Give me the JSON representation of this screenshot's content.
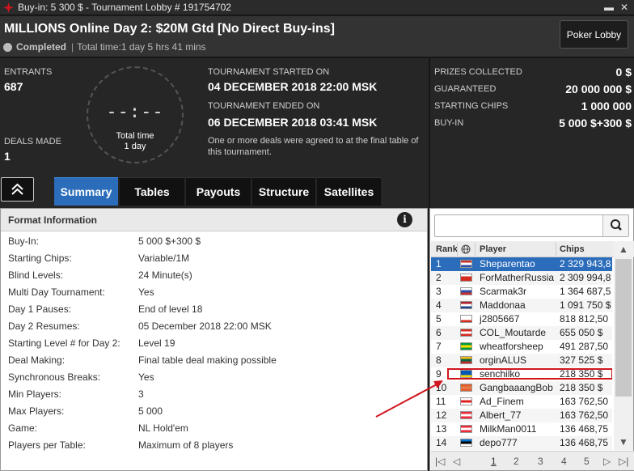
{
  "window": {
    "title": "Buy-in: 5 300 $ - Tournament Lobby # 191754702",
    "minimize_glyph": "▬",
    "close_glyph": "✕"
  },
  "header": {
    "tournament_name": "MILLIONS Online Day 2: $20M Gtd [No Direct Buy-ins]",
    "status": "Completed",
    "separator": "|",
    "total_time": "Total time:1 day 5 hrs  41 mins",
    "lobby_button": "Poker Lobby"
  },
  "info": {
    "entrants_label": "ENTRANTS",
    "entrants_value": "687",
    "deals_label": "DEALS MADE",
    "deals_value": "1",
    "clock_digits": "--:--",
    "clock_line1": "Total time",
    "clock_line2": "1 day",
    "started_label": "TOURNAMENT STARTED ON",
    "started_value": "04 DECEMBER 2018  22:00 MSK",
    "ended_label": "TOURNAMENT ENDED ON",
    "ended_value": "06 DECEMBER 2018  03:41 MSK",
    "note": "One or more deals were agreed to at the final table of this tournament."
  },
  "prizes": [
    {
      "label": "PRIZES COLLECTED",
      "value": "0 $"
    },
    {
      "label": "GUARANTEED",
      "value": "20 000 000 $"
    },
    {
      "label": "STARTING CHIPS",
      "value": "1 000 000"
    },
    {
      "label": "BUY-IN",
      "value": "5 000 $+300 $"
    }
  ],
  "collapse_glyph": "︽",
  "tabs": [
    {
      "label": "Summary",
      "active": true
    },
    {
      "label": "Tables",
      "active": false
    },
    {
      "label": "Payouts",
      "active": false
    },
    {
      "label": "Structure",
      "active": false
    },
    {
      "label": "Satellites",
      "active": false
    }
  ],
  "format": {
    "title": "Format Information",
    "info_glyph": "i",
    "rows": [
      {
        "k": "Buy-In:",
        "v": "5 000 $+300 $"
      },
      {
        "k": "Starting Chips:",
        "v": "Variable/1M"
      },
      {
        "k": "Blind Levels:",
        "v": "24 Minute(s)"
      },
      {
        "k": "Multi Day Tournament:",
        "v": "Yes"
      },
      {
        "k": "Day 1 Pauses:",
        "v": "End of level 18"
      },
      {
        "k": "Day 2 Resumes:",
        "v": "05 December 2018  22:00 MSK"
      },
      {
        "k": "Starting Level # for Day 2:",
        "v": "Level 19"
      },
      {
        "k": "Deal Making:",
        "v": "Final table deal making possible"
      },
      {
        "k": "Synchronous Breaks:",
        "v": "Yes"
      },
      {
        "k": "Min Players:",
        "v": "3"
      },
      {
        "k": "Max Players:",
        "v": "5 000"
      },
      {
        "k": "Game:",
        "v": "NL Hold'em"
      },
      {
        "k": "Players per Table:",
        "v": "Maximum of 8 players"
      }
    ]
  },
  "players": {
    "search_placeholder": "",
    "columns": {
      "rank": "Rank",
      "player": "Player",
      "chips": "Chips"
    },
    "highlighted_rank": 9,
    "rows": [
      {
        "rank": "1",
        "name": "Sheparentao",
        "chips": "2 329 943,8",
        "flag": [
          "#cc2b2b",
          "#ffffff",
          "#2b4fa8"
        ]
      },
      {
        "rank": "2",
        "name": "ForMatherRussia",
        "chips": "2 309 994,8",
        "flag": [
          "#ffffff",
          "#d52b1e",
          "#d52b1e"
        ]
      },
      {
        "rank": "3",
        "name": "Scarmak3r",
        "chips": "1 364 687,5",
        "flag": [
          "#ffffff",
          "#2b4fa8",
          "#cc2b2b"
        ]
      },
      {
        "rank": "4",
        "name": "Maddonaa",
        "chips": "1 091 750 $",
        "flag": [
          "#ae1c28",
          "#ffffff",
          "#21468b"
        ]
      },
      {
        "rank": "5",
        "name": "j2805667",
        "chips": "818 812,50",
        "flag": [
          "#ffffff",
          "#ffffff",
          "#d52b1e"
        ]
      },
      {
        "rank": "6",
        "name": "COL_Moutarde",
        "chips": "655 050 $",
        "flag": [
          "#d52b1e",
          "#ffffff",
          "#d52b1e"
        ]
      },
      {
        "rank": "7",
        "name": "wheatforsheep",
        "chips": "491 287,50",
        "flag": [
          "#009b3a",
          "#fedf00",
          "#009b3a"
        ]
      },
      {
        "rank": "8",
        "name": "orginALUS",
        "chips": "327 525 $",
        "flag": [
          "#fdb913",
          "#006a44",
          "#c1272d"
        ]
      },
      {
        "rank": "9",
        "name": "senchilko",
        "chips": "218 350 $",
        "flag": [
          "#0057b7",
          "#0057b7",
          "#ffd700"
        ]
      },
      {
        "rank": "10",
        "name": "GangbaaangBob",
        "chips": "218 350 $",
        "flag": [
          "#e55a2b",
          "#e5804b",
          "#e55a2b"
        ]
      },
      {
        "rank": "11",
        "name": "Ad_Finem",
        "chips": "163 762,50",
        "flag": [
          "#ffffff",
          "#e02020",
          "#ffffff"
        ]
      },
      {
        "rank": "12",
        "name": "Albert_77",
        "chips": "163 762,50",
        "flag": [
          "#ed2939",
          "#ffffff",
          "#ed2939"
        ]
      },
      {
        "rank": "13",
        "name": "MilkMan0011",
        "chips": "136 468,75",
        "flag": [
          "#ed2939",
          "#ffffff",
          "#ed2939"
        ]
      },
      {
        "rank": "14",
        "name": "depo777",
        "chips": "136 468,75",
        "flag": [
          "#0072ce",
          "#000000",
          "#ffffff"
        ]
      }
    ],
    "pager": {
      "first": "|◁",
      "prev": "◁",
      "pages": [
        "1",
        "2",
        "3",
        "4",
        "5"
      ],
      "current": "1",
      "next": "▷",
      "last": "▷|"
    }
  }
}
